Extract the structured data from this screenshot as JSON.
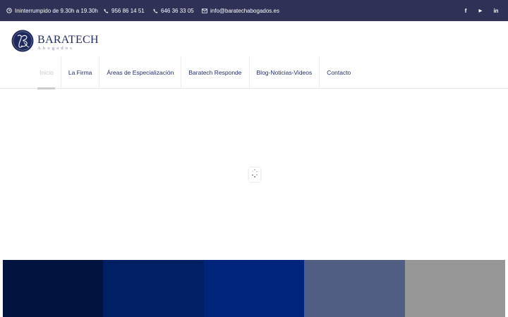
{
  "topbar": {
    "hours": "Ininterrumpido de 9.30h a 19.30h",
    "phone1": "956 86 14 51",
    "phone2": "646 36 33 05",
    "email": "info@baratechabogados.es",
    "social": [
      "facebook-icon",
      "youtube-icon",
      "linkedin-icon"
    ],
    "social_glyphs": {
      "facebook": "f",
      "youtube": "▶",
      "linkedin": "in"
    }
  },
  "logo": {
    "name": "BARATECH",
    "subtitle": "Abogados"
  },
  "nav": {
    "items": [
      {
        "label": "Inicio",
        "active": true
      },
      {
        "label": "La Firma",
        "active": false
      },
      {
        "label": "Áreas de Especialización",
        "active": false
      },
      {
        "label": "Baratech Responde",
        "active": false
      },
      {
        "label": "Blog-Noticias-Videos",
        "active": false
      },
      {
        "label": "Contacto",
        "active": false
      }
    ]
  },
  "colors": {
    "topbar_bg": "#2f3157",
    "brand_navy": "#1e2a5c",
    "swatches": [
      "#001440",
      "#001f65",
      "#00237c",
      "#4f5e82",
      "#969696"
    ]
  }
}
